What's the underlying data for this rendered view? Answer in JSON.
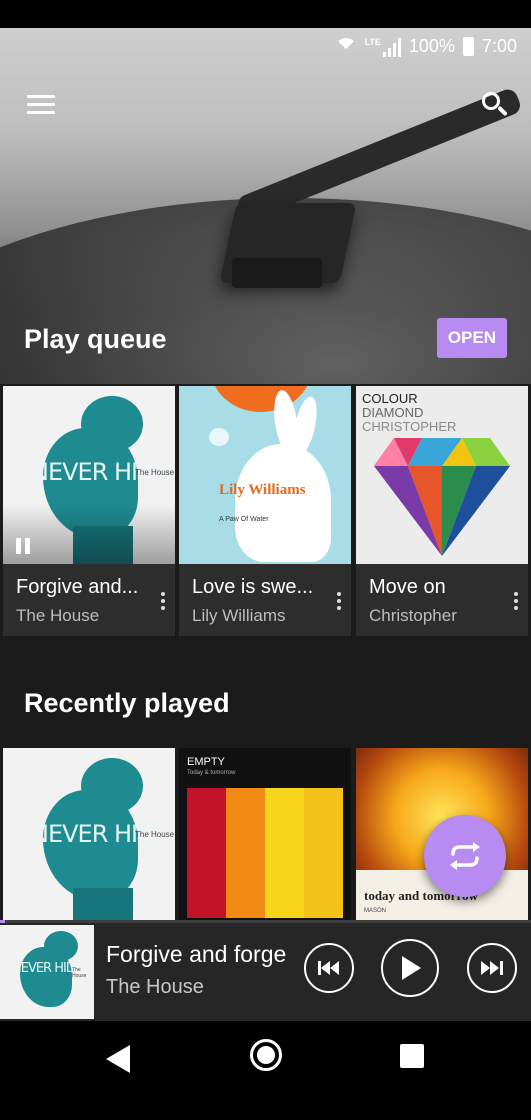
{
  "status_bar": {
    "network": "LTE",
    "battery": "100%",
    "time": "7:00"
  },
  "header": {
    "menu_icon": "hamburger-menu-icon",
    "search_icon": "search-icon"
  },
  "play_queue": {
    "title": "Play queue",
    "open_label": "OPEN",
    "items": [
      {
        "title": "Forgive and...",
        "artist": "The House",
        "art_text": "NEVER HIDE",
        "art_sub": "The House",
        "state": "paused"
      },
      {
        "title": "Love is swe...",
        "artist": "Lily Williams",
        "art_text": "Lily Williams",
        "art_sub": "A Paw Of Water"
      },
      {
        "title": "Move on",
        "artist": "Christopher",
        "art_lines": [
          "COLOUR",
          "DIAMOND",
          "CHRISTOPHER"
        ]
      }
    ]
  },
  "recently_played": {
    "title": "Recently played",
    "items": [
      {
        "art_text": "NEVER HIDE",
        "art_sub": "The House"
      },
      {
        "art_text": "EMPTY",
        "art_sub": "Today & tomorrow"
      },
      {
        "art_text": "today and tomorrow",
        "art_sub": "MASON"
      }
    ]
  },
  "now_playing": {
    "title": "Forgive and forge",
    "artist": "The House",
    "thumb_text": "NEVER HIDE",
    "thumb_sub": "The House",
    "progress": 0.01
  },
  "colors": {
    "accent": "#b78bf2",
    "background": "#1b1b1b",
    "card": "#2d2d2d",
    "player": "#262626"
  }
}
